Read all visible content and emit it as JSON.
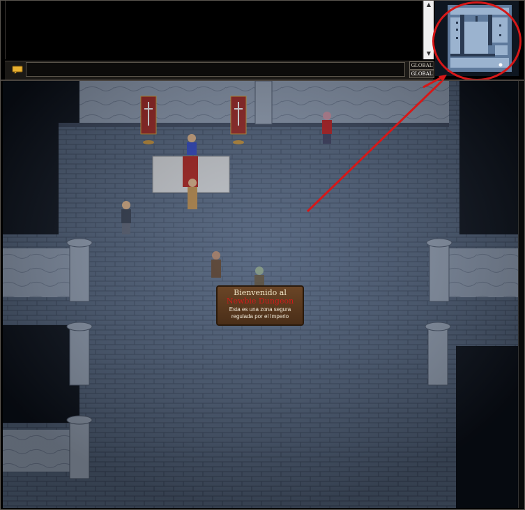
{
  "chat": {
    "input_value": "",
    "channel_top": "GLOBAL",
    "channel_bottom": "GLOBAL",
    "scroll_up": "▲",
    "scroll_down": "▼"
  },
  "sign": {
    "line1": "Bienvenido al",
    "line2": "Newbie Dungeon",
    "line3": "Esta es una zona segura",
    "line4": "regulada por el Imperio"
  },
  "colors": {
    "annotation": "#d61818",
    "sign_title_accent": "#d01a1a"
  }
}
